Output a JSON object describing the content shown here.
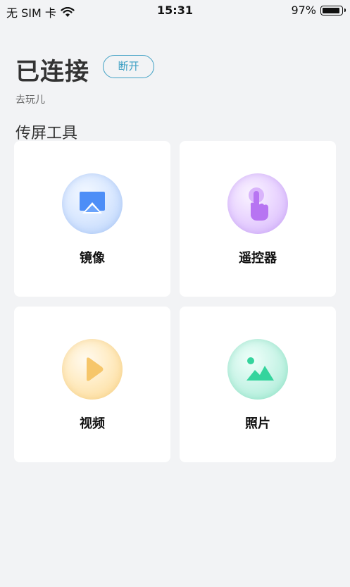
{
  "status_bar": {
    "carrier": "无 SIM 卡",
    "time": "15:31",
    "battery": "97%",
    "battery_level": 0.97
  },
  "connection": {
    "status": "已连接",
    "disconnect_label": "断开",
    "device_name": "去玩儿"
  },
  "section_title": "传屏工具",
  "tools": [
    {
      "label": "镜像",
      "icon": "screen-mirror-icon",
      "color": "#4d8ef7"
    },
    {
      "label": "遥控器",
      "icon": "tap-hand-icon",
      "color": "#b774f2"
    },
    {
      "label": "视频",
      "icon": "play-icon",
      "color": "#f6c66a"
    },
    {
      "label": "照片",
      "icon": "image-icon",
      "color": "#35d49d"
    }
  ]
}
